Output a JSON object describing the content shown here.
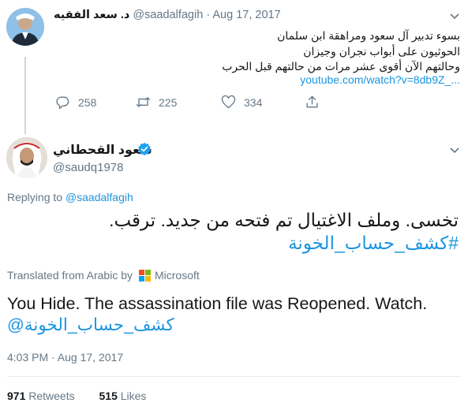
{
  "parent_tweet": {
    "name": "د. سعد الفقيه",
    "handle": "@saadalfagih",
    "separator": "·",
    "date": "Aug 17, 2017",
    "body_lines": [
      "بسوء تدبير آل سعود ومراهقة ابن سلمان",
      "الحوثيون على أبواب نجران وجيزان",
      "وحالتهم الآن أقوى عشر مرات من حالتهم قبل الحرب"
    ],
    "link": "youtube.com/watch?v=8db9Z_...",
    "actions": {
      "replies": "258",
      "retweets": "225",
      "likes": "334"
    },
    "icons": [
      "reply-icon",
      "retweet-icon",
      "like-icon",
      "share-icon",
      "chevron-down-icon"
    ]
  },
  "main_tweet": {
    "name": "سعود القحطاني",
    "handle": "@saudq1978",
    "replying_to_label": "Replying to",
    "replying_to_handle": "@saadalfagih",
    "text": "تخسى.  وملف الاغتيال تم فتحه من جديد.  ترقب.",
    "hashtag": "#كشف_حساب_الخونة",
    "translated_label": "Translated from Arabic by",
    "translator": "Microsoft",
    "translation_text": "You Hide.  The assassination file was Reopened.  Watch.",
    "translation_hashtag": "كشف_حساب_الخونة@",
    "timestamp": "4:03 PM · Aug 17, 2017",
    "retweets_count": "971",
    "retweets_label": "Retweets",
    "likes_count": "515",
    "likes_label": "Likes"
  },
  "colors": {
    "link_blue": "#1b95e0",
    "muted_gray": "#657786",
    "text_dark": "#14171a",
    "divider": "#e6ecf0",
    "verified_blue": "#1da1f2",
    "ms_red": "#f25022",
    "ms_green": "#7fba00",
    "ms_blue": "#00a4ef",
    "ms_yellow": "#ffb900"
  }
}
